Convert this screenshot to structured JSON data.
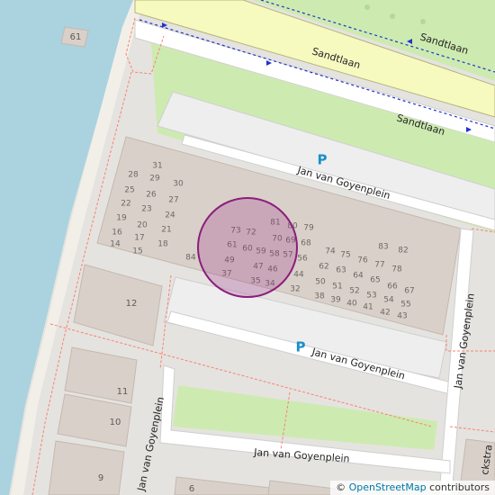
{
  "map": {
    "streets": {
      "sandtlaan_1": "Sandtlaan",
      "sandtlaan_2": "Sandtlaan",
      "sandtlaan_3": "Sandtlaan",
      "goyenplein_1": "Jan van Goyenplein",
      "goyenplein_2": "Jan van Goyenplein",
      "goyenplein_3": "Jan van Goyenplein",
      "goyenplein_4": "Jan van Goyenplein",
      "partial_street": "ckstra"
    },
    "parking_labels": [
      "P",
      "P"
    ],
    "house_numbers": {
      "n61_canal": "61",
      "n12": "12",
      "n11": "11",
      "n10": "10",
      "n9": "9",
      "n6": "6",
      "b31": "31",
      "b29": "29",
      "b30": "30",
      "b28": "28",
      "b25": "25",
      "b26": "26",
      "b27": "27",
      "b22": "22",
      "b23": "23",
      "b24": "24",
      "b19": "19",
      "b20": "20",
      "b21": "21",
      "b16": "16",
      "b17": "17",
      "b18": "18",
      "b14": "14",
      "b15": "15",
      "b84": "84",
      "b73": "73",
      "b72": "72",
      "b61": "61",
      "b60": "60",
      "b59": "59",
      "b49": "49",
      "b47": "47",
      "b46": "46",
      "b37": "37",
      "b35": "35",
      "b34": "34",
      "b81": "81",
      "b80": "80",
      "b79": "79",
      "b70": "70",
      "b69": "69",
      "b68": "68",
      "b58": "58",
      "b57": "57",
      "b56": "56",
      "b44": "44",
      "b32": "32",
      "b74": "74",
      "b75": "75",
      "b76": "76",
      "b77": "77",
      "b78": "78",
      "b83": "83",
      "b82": "82",
      "b62": "62",
      "b63": "63",
      "b64": "64",
      "b65": "65",
      "b66": "66",
      "b67": "67",
      "b50": "50",
      "b51": "51",
      "b52": "52",
      "b53": "53",
      "b54": "54",
      "b55": "55",
      "b38": "38",
      "b39": "39",
      "b40": "40",
      "b41": "41",
      "b42": "42",
      "b43": "43"
    },
    "highlight_color": "#9b2a8a",
    "water_color": "#aad3df",
    "grass_color": "#cdebb0",
    "building_color": "#d9d0c9",
    "parking_color": "#eeeeee",
    "main_road_color": "#f7fabf",
    "path_color": "#fa8072"
  },
  "attribution": {
    "copyright": "©",
    "link": "OpenStreetMap",
    "suffix": "contributors"
  }
}
